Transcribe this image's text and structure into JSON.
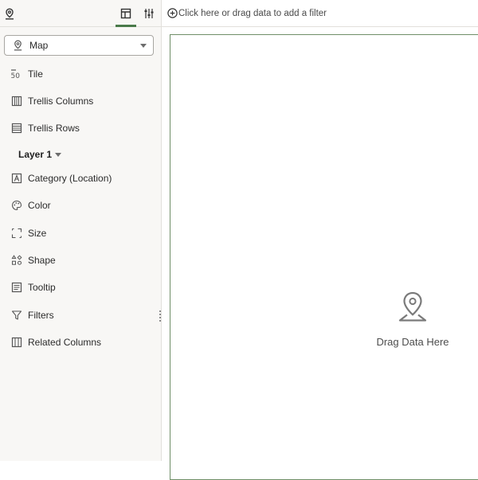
{
  "toolbar": {
    "icons": [
      "map-pin-icon",
      "grammar-panel-icon",
      "properties-sliders-icon"
    ],
    "active_tab": "grammar-panel-icon"
  },
  "visualization": {
    "type_label": "Map",
    "icon": "map-pin-icon"
  },
  "grammar": {
    "top_items": [
      {
        "label": "Tile",
        "icon": "tile-icon"
      },
      {
        "label": "Trellis Columns",
        "icon": "trellis-columns-icon"
      },
      {
        "label": "Trellis Rows",
        "icon": "trellis-rows-icon"
      }
    ],
    "layer_label": "Layer 1",
    "layer_items": [
      {
        "label": "Category (Location)",
        "icon": "category-icon"
      },
      {
        "label": "Color",
        "icon": "palette-icon"
      },
      {
        "label": "Size",
        "icon": "size-icon"
      },
      {
        "label": "Shape",
        "icon": "shape-icon"
      },
      {
        "label": "Tooltip",
        "icon": "tooltip-icon"
      },
      {
        "label": "Filters",
        "icon": "filter-icon"
      },
      {
        "label": "Related Columns",
        "icon": "related-columns-icon"
      }
    ]
  },
  "filter_bar": {
    "placeholder": "Click here or drag data to add a filter",
    "icon": "add-circle-icon"
  },
  "canvas": {
    "drop_message": "Drag Data Here",
    "icon": "map-pin-icon"
  },
  "colors": {
    "accent": "#4a7a4a",
    "panel_bg": "#f8f7f5",
    "canvas_border": "#6f8f68"
  }
}
